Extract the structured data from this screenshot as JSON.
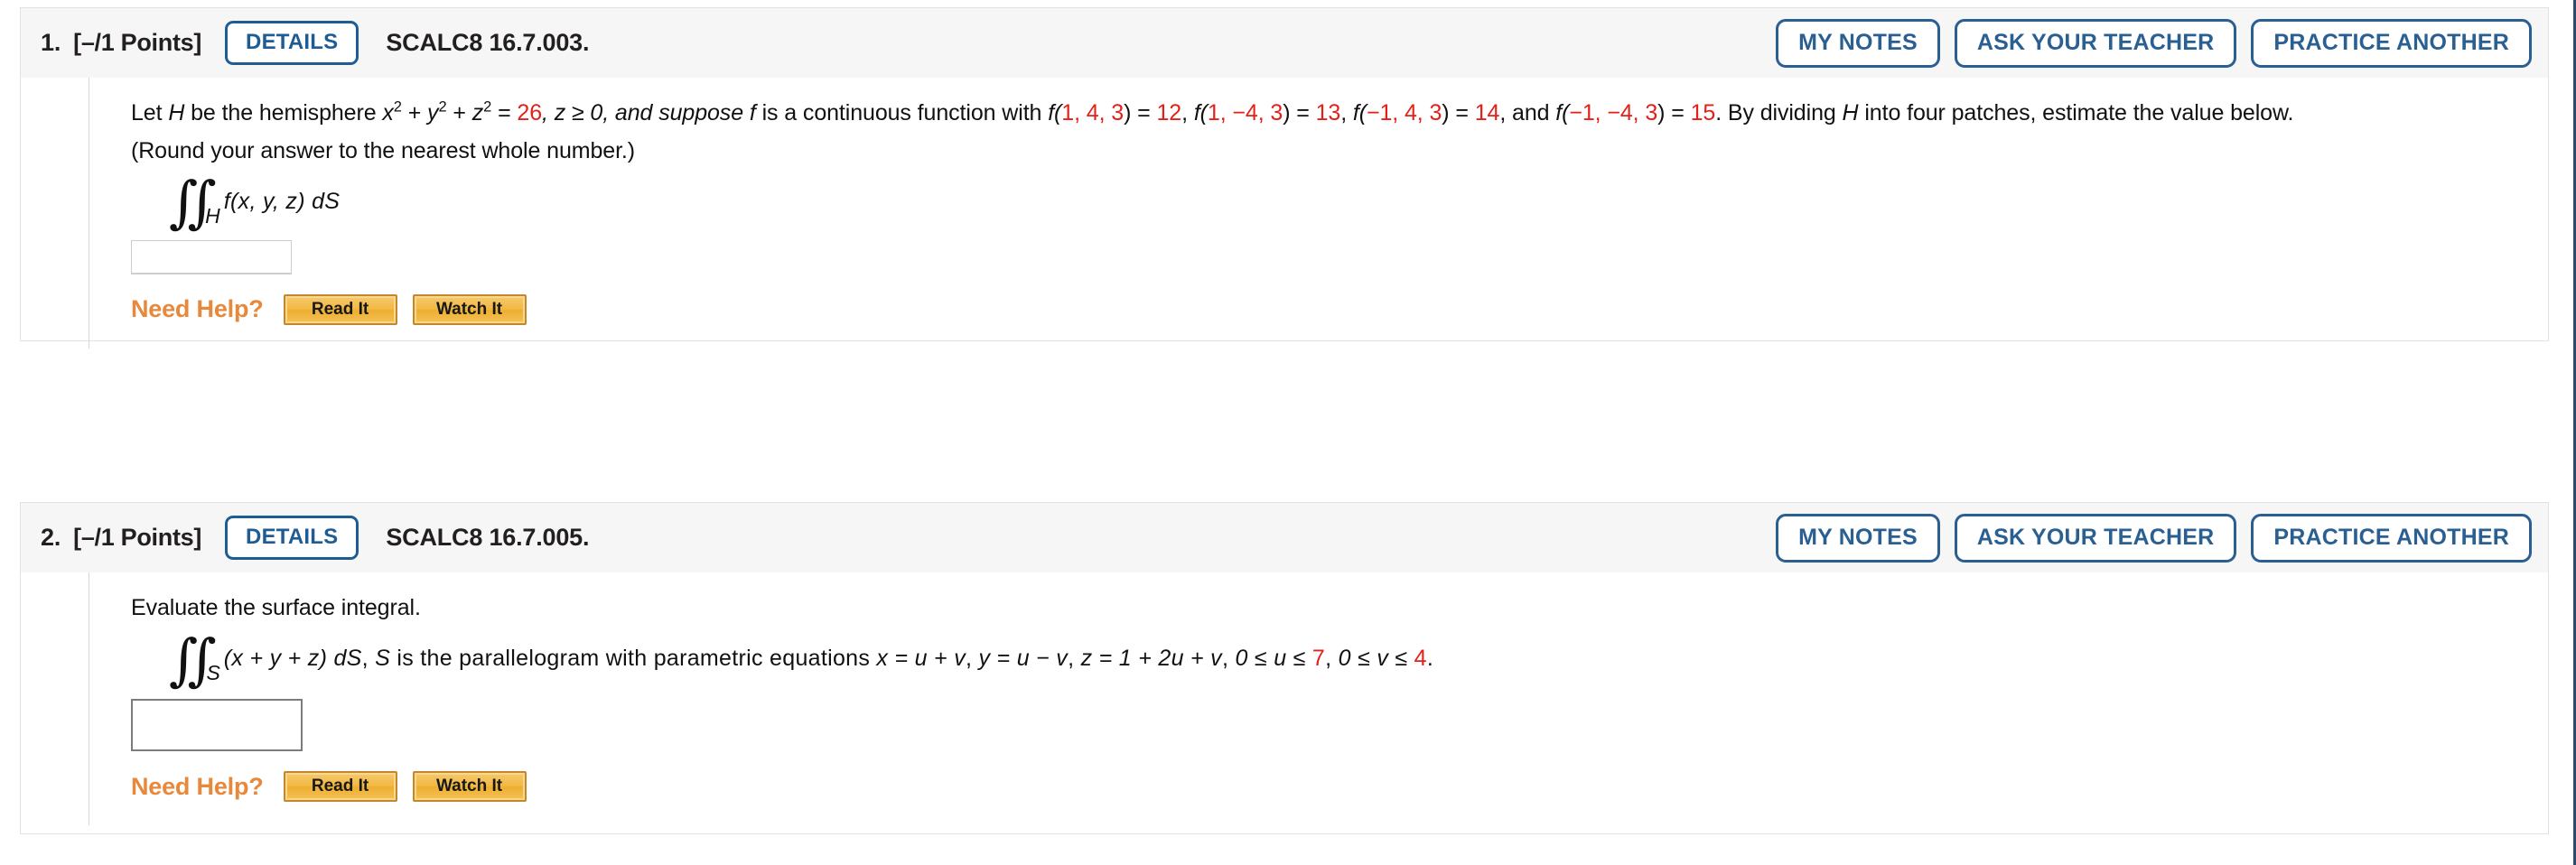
{
  "problems": [
    {
      "number": "1.",
      "points": "[–/1 Points]",
      "details_label": "DETAILS",
      "code": "SCALC8 16.7.003.",
      "actions": [
        "MY NOTES",
        "ASK YOUR TEACHER",
        "PRACTICE ANOTHER"
      ],
      "q_line1_a": "Let ",
      "q_line1_H": "H",
      "q_line1_b": " be the hemisphere  ",
      "q_line1_x": "x",
      "q_line1_plus1": " + ",
      "q_line1_y": "y",
      "q_line1_plus2": " + ",
      "q_line1_z": "z",
      "q_line1_eq": " = ",
      "q_line1_val26": "26",
      "q_line1_zcond": ", z ≥ 0,  and suppose ",
      "q_line1_f": "f",
      "q_line1_c": " is a continuous function with  ",
      "f1_open": "f(",
      "f1_args": "1, 4, 3",
      "f1_close": ") = ",
      "f1_val": "12",
      "f1_sep": ",   ",
      "f2_open": "f(",
      "f2_args": "1, −4, 3",
      "f2_close": ") = ",
      "f2_val": "13",
      "f2_sep": ",   ",
      "f3_open": "f(",
      "f3_args": "−1, 4, 3",
      "f3_close": ") = ",
      "f3_val": "14",
      "f3_sep": ",  and  ",
      "f4_open": "f(",
      "f4_args": "−1, −4, 3",
      "f4_close": ") = ",
      "f4_val": "15",
      "q_line1_tail_a": ".  By dividing ",
      "q_line1_tail_H": "H",
      "q_line1_tail_b": " into four patches, estimate the value below.",
      "q_line2": "(Round your answer to the nearest whole number.)",
      "integral_symbol": "∬",
      "integral_sub": "H",
      "integral_tail": "f(x, y, z) dS",
      "answer_value": "",
      "need_help_label": "Need Help?",
      "help_buttons": [
        "Read It",
        "Watch It"
      ]
    },
    {
      "number": "2.",
      "points": "[–/1 Points]",
      "details_label": "DETAILS",
      "code": "SCALC8 16.7.005.",
      "actions": [
        "MY NOTES",
        "ASK YOUR TEACHER",
        "PRACTICE ANOTHER"
      ],
      "q_line1": "Evaluate the surface integral.",
      "integral_symbol": "∬",
      "integral_sub": "S",
      "expr_paren": "(x + y + z) dS",
      "expr_comma": ",  ",
      "expr_S": "S",
      "expr_desc": " is the parallelogram with parametric equations  ",
      "eq_x": "x = u + v",
      "eq_sep1": ",   ",
      "eq_y": "y = u − v",
      "eq_sep2": ",   ",
      "eq_z": "z = 1 + 2u + v",
      "eq_sep3": ",   ",
      "bound_u_pre": "0 ≤ u ≤ ",
      "bound_u_val": "7",
      "bound_sep": ",   ",
      "bound_v_pre": "0 ≤ v ≤ ",
      "bound_v_val": "4",
      "bound_end": ".",
      "answer_value": "",
      "need_help_label": "Need Help?",
      "help_buttons": [
        "Read It",
        "Watch It"
      ]
    }
  ],
  "colors": {
    "accent_blue": "#2a5f92",
    "highlight_red": "#e32119",
    "need_help_orange": "#e8883a",
    "help_button_gold": "#f1b945"
  }
}
